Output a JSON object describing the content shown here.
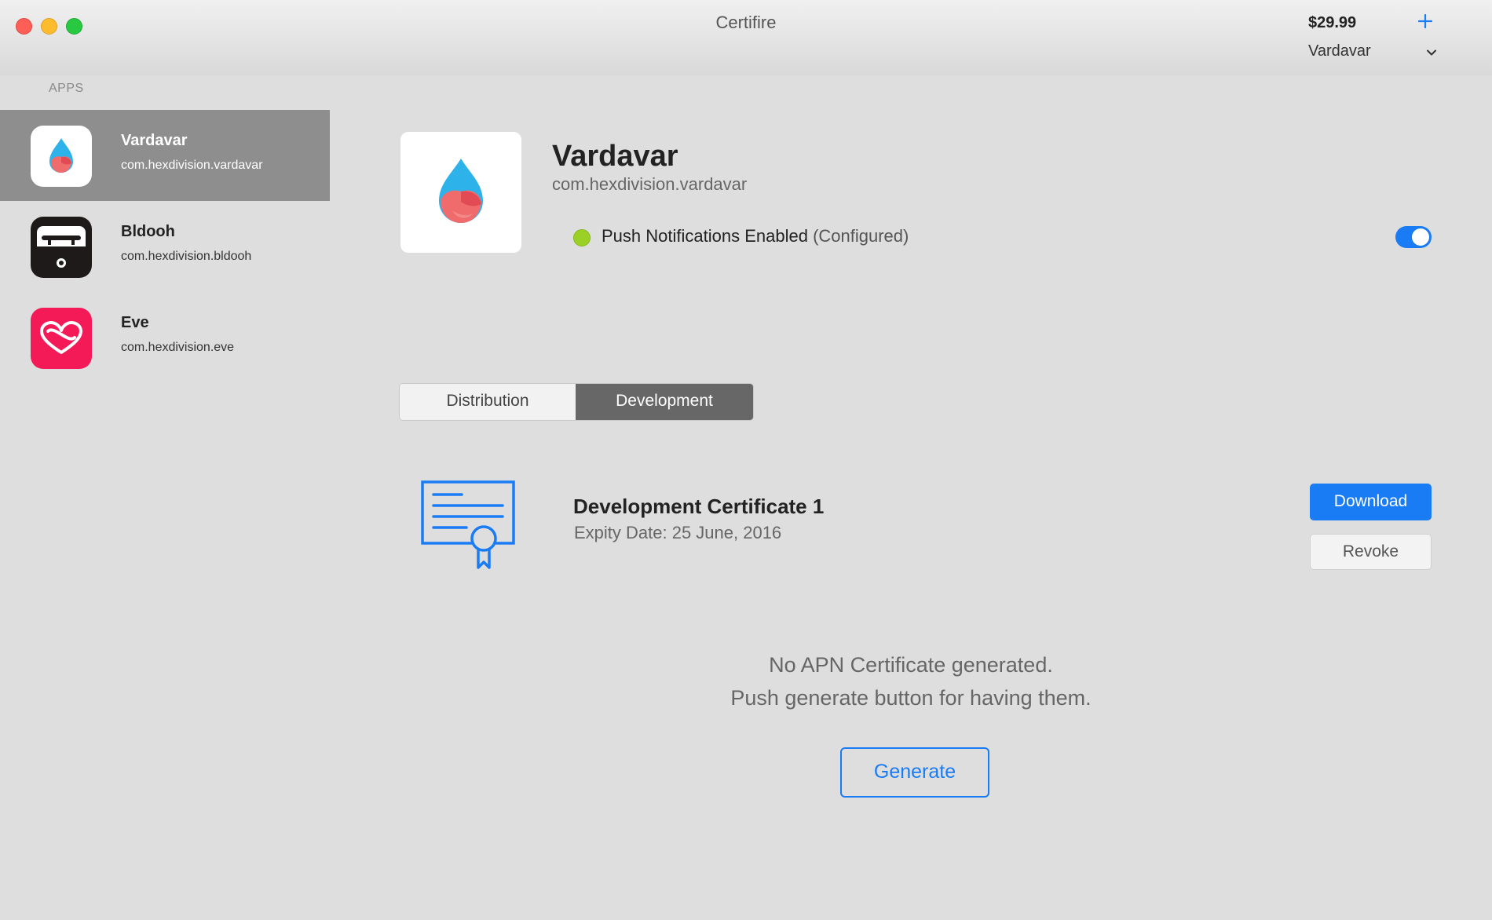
{
  "window": {
    "title": "Certifire"
  },
  "toolbar": {
    "price": "$29.99",
    "add_icon": "plus-icon",
    "account": "Vardavar"
  },
  "sidebar": {
    "header": "APPS",
    "items": [
      {
        "name": "Vardavar",
        "bundle": "com.hexdivision.vardavar",
        "icon": "water-drop-icon",
        "selected": true
      },
      {
        "name": "Bldooh",
        "bundle": "com.hexdivision.bldooh",
        "icon": "bus-icon",
        "selected": false
      },
      {
        "name": "Eve",
        "bundle": "com.hexdivision.eve",
        "icon": "heart-loop-icon",
        "selected": false
      }
    ]
  },
  "detail": {
    "name": "Vardavar",
    "bundle": "com.hexdivision.vardavar",
    "push_label": "Push Notifications Enabled",
    "push_status": "(Configured)",
    "push_enabled": true
  },
  "tabs": [
    {
      "label": "Distribution",
      "active": false
    },
    {
      "label": "Development",
      "active": true
    }
  ],
  "certificate": {
    "title": "Development Certificate 1",
    "expiry": "Expity Date: 25 June, 2016",
    "download_label": "Download",
    "revoke_label": "Revoke"
  },
  "apn": {
    "empty_line1": "No APN Certificate generated.",
    "empty_line2": "Push generate button for having them.",
    "generate_label": "Generate"
  },
  "colors": {
    "accent": "#1a7cf5",
    "status_ok": "#9bd126",
    "selection": "#8e8e8e"
  }
}
